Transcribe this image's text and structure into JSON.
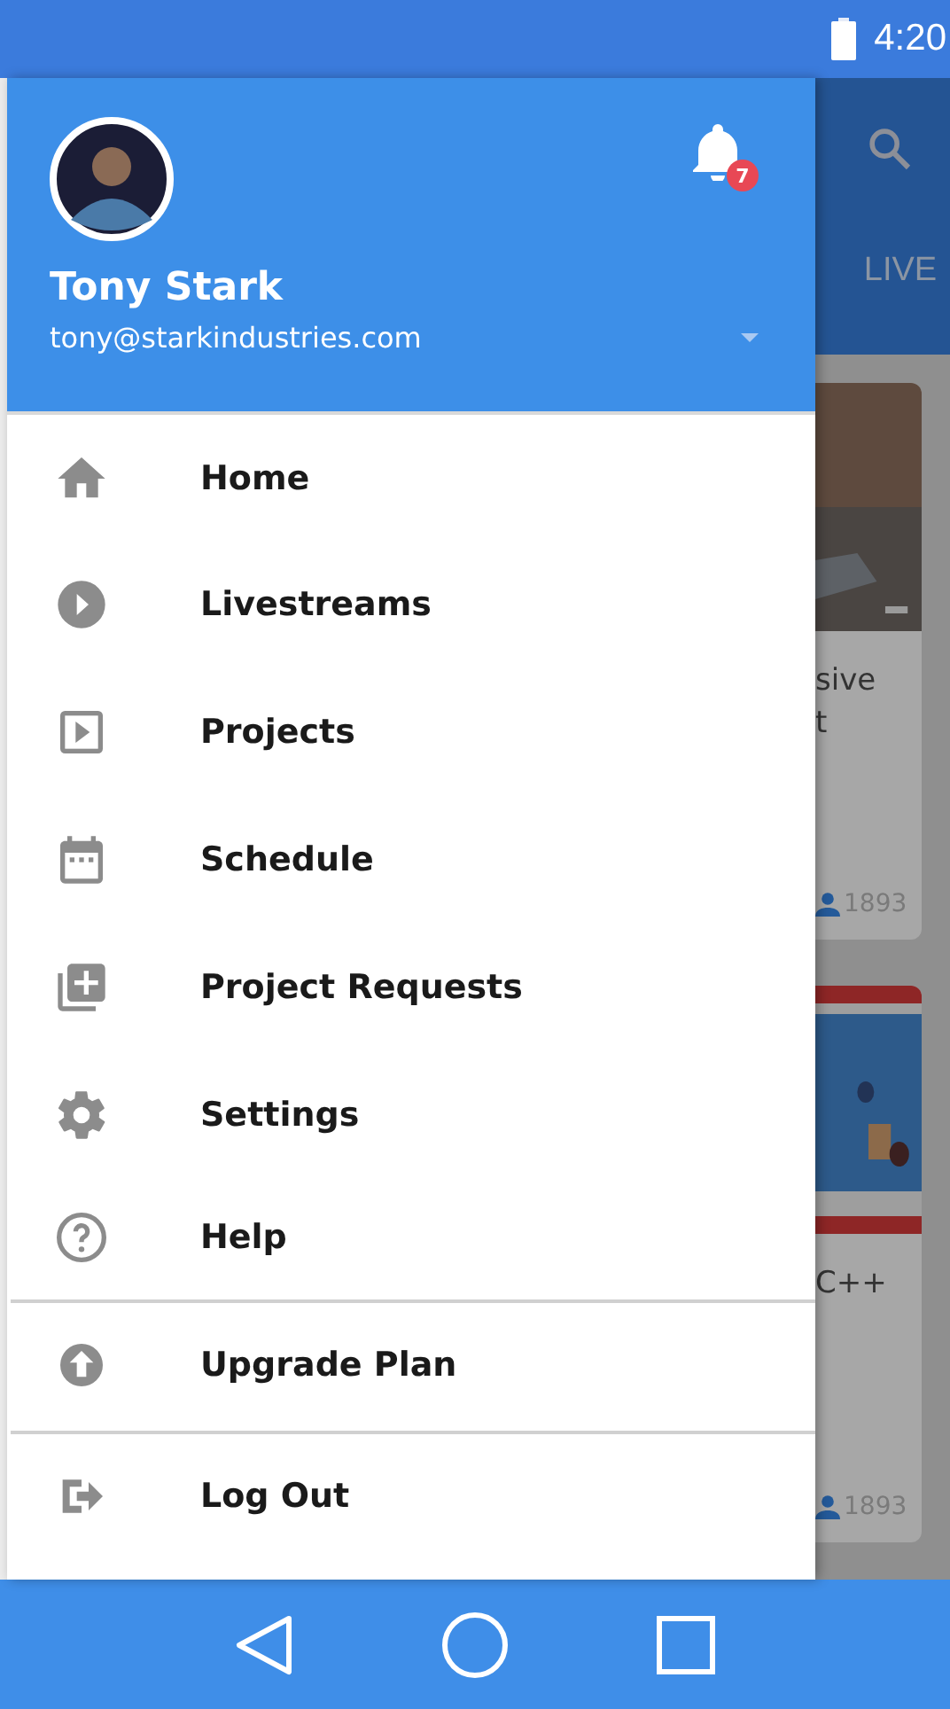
{
  "status_bar": {
    "time": "4:20"
  },
  "drawer": {
    "user": {
      "name": "Tony Stark",
      "email": "tony@starkindustries.com"
    },
    "notifications": {
      "count": "7"
    },
    "sections": [
      {
        "items": [
          {
            "label": "Home"
          },
          {
            "label": "Livestreams"
          },
          {
            "label": "Projects"
          },
          {
            "label": "Schedule"
          },
          {
            "label": "Project Requests"
          },
          {
            "label": "Settings"
          },
          {
            "label": "Help"
          }
        ]
      },
      {
        "items": [
          {
            "label": "Upgrade Plan"
          }
        ]
      },
      {
        "items": [
          {
            "label": "Log Out"
          }
        ]
      }
    ]
  },
  "background": {
    "tab": "LIVE",
    "cards": [
      {
        "title_lines": [
          "sive",
          "t"
        ],
        "viewers": "1893"
      },
      {
        "title_lines": [
          "C++"
        ],
        "viewers": "1893"
      }
    ]
  }
}
